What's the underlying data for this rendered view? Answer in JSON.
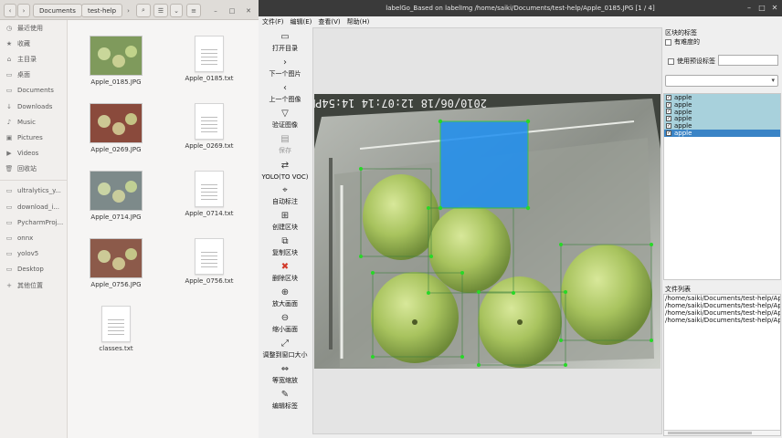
{
  "file_manager": {
    "path": [
      "Documents",
      "test-help"
    ],
    "sidebar": [
      {
        "icon": "clock-icon",
        "label": "最近使用"
      },
      {
        "icon": "star-icon",
        "label": "收藏"
      },
      {
        "icon": "home-icon",
        "label": "主目录"
      },
      {
        "icon": "folder-icon",
        "label": "桌面"
      },
      {
        "icon": "folder-icon",
        "label": "Documents"
      },
      {
        "icon": "download-icon",
        "label": "Downloads"
      },
      {
        "icon": "music-icon",
        "label": "Music"
      },
      {
        "icon": "picture-icon",
        "label": "Pictures"
      },
      {
        "icon": "video-icon",
        "label": "Videos"
      },
      {
        "icon": "trash-icon",
        "label": "回收站"
      },
      {
        "icon": "folder-icon",
        "label": "ultralytics_y..."
      },
      {
        "icon": "folder-icon",
        "label": "download_i..."
      },
      {
        "icon": "folder-icon",
        "label": "PycharmProj..."
      },
      {
        "icon": "folder-icon",
        "label": "onnx"
      },
      {
        "icon": "folder-icon",
        "label": "yolov5"
      },
      {
        "icon": "folder-icon",
        "label": "Desktop"
      },
      {
        "icon": "plus-icon",
        "label": "其他位置"
      }
    ],
    "files": [
      {
        "name": "Apple_0185.JPG",
        "kind": "image"
      },
      {
        "name": "Apple_0185.txt",
        "kind": "text"
      },
      {
        "name": "Apple_0269.JPG",
        "kind": "image"
      },
      {
        "name": "Apple_0269.txt",
        "kind": "text"
      },
      {
        "name": "Apple_0714.JPG",
        "kind": "image"
      },
      {
        "name": "Apple_0714.txt",
        "kind": "text"
      },
      {
        "name": "Apple_0756.JPG",
        "kind": "image"
      },
      {
        "name": "Apple_0756.txt",
        "kind": "text"
      },
      {
        "name": "classes.txt",
        "kind": "text"
      }
    ]
  },
  "labelimg": {
    "title": "labelGo_Based on labelImg /home/saiki/Documents/test-help/Apple_0185.JPG [1 / 4]",
    "menu": [
      "文件(F)",
      "编辑(E)",
      "查看(V)",
      "帮助(H)"
    ],
    "tools": [
      {
        "icon": "folder-icon",
        "label": "打开目录",
        "enabled": true
      },
      {
        "icon": "next-icon",
        "label": "下一个图片",
        "enabled": true
      },
      {
        "icon": "prev-icon",
        "label": "上一个图像",
        "enabled": true
      },
      {
        "icon": "verify-icon",
        "label": "验证图像",
        "enabled": true
      },
      {
        "icon": "save-icon",
        "label": "保存",
        "enabled": false
      },
      {
        "icon": "convert-icon",
        "label": "YOLO(TO VOC)",
        "enabled": true
      },
      {
        "icon": "auto-label-icon",
        "label": "自动标注",
        "enabled": true
      },
      {
        "icon": "create-box-icon",
        "label": "创建区块",
        "enabled": true
      },
      {
        "icon": "copy-box-icon",
        "label": "复制区块",
        "enabled": true
      },
      {
        "icon": "delete-box-icon",
        "label": "删除区块",
        "enabled": true
      },
      {
        "icon": "zoom-in-icon",
        "label": "放大画面",
        "enabled": true
      },
      {
        "icon": "zoom-out-icon",
        "label": "缩小画面",
        "enabled": true
      },
      {
        "icon": "fit-window-icon",
        "label": "调整到窗口大小",
        "enabled": true
      },
      {
        "icon": "fit-width-icon",
        "label": "等宽缩放",
        "enabled": true
      },
      {
        "icon": "edit-label-icon",
        "label": "编辑标签",
        "enabled": true
      }
    ],
    "photo_timestamp": "2010/06/18 12:07:14 14:54PM",
    "dock": {
      "title": "区块的标签",
      "difficult_label": "有难度的",
      "use_default_label": "使用预设标签",
      "labels": [
        "apple",
        "apple",
        "apple",
        "apple",
        "apple",
        "apple"
      ],
      "selected_index": 5,
      "file_list_title": "文件列表",
      "files": [
        "/home/saiki/Documents/test-help/Apple_0185.JPG",
        "/home/saiki/Documents/test-help/Apple_0269.JPG",
        "/home/saiki/Documents/test-help/Apple_0714.JPG",
        "/home/saiki/Documents/test-help/Apple_0756.JPG"
      ]
    }
  },
  "colors": {
    "selected_box_fill": "#1e8ff0",
    "box_stroke": "#00c800",
    "label_row_bg": "#a8d1dc",
    "label_row_selected": "#3a84c6"
  }
}
